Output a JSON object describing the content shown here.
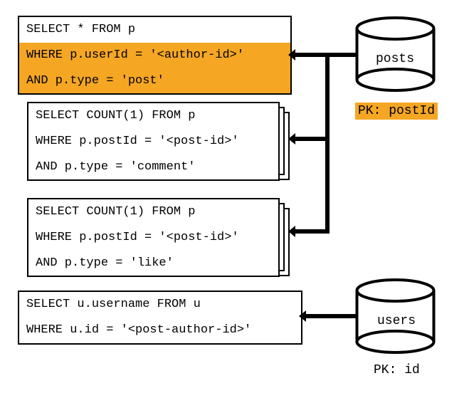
{
  "queries": {
    "q1": {
      "line1": "SELECT * FROM p",
      "line2": "WHERE p.userId = '<author-id>'",
      "line3": "AND p.type = 'post'"
    },
    "q2": {
      "line1": "SELECT COUNT(1) FROM p",
      "line2": "WHERE p.postId = '<post-id>'",
      "line3": "AND p.type = 'comment'"
    },
    "q3": {
      "line1": "SELECT COUNT(1) FROM p",
      "line2": "WHERE p.postId = '<post-id>'",
      "line3": "AND p.type = 'like'"
    },
    "q4": {
      "line1": "SELECT u.username FROM u",
      "line2": "WHERE u.id = '<post-author-id>'"
    }
  },
  "databases": {
    "posts": {
      "label": "posts",
      "pk": "PK: postId"
    },
    "users": {
      "label": "users",
      "pk": "PK: id"
    }
  }
}
